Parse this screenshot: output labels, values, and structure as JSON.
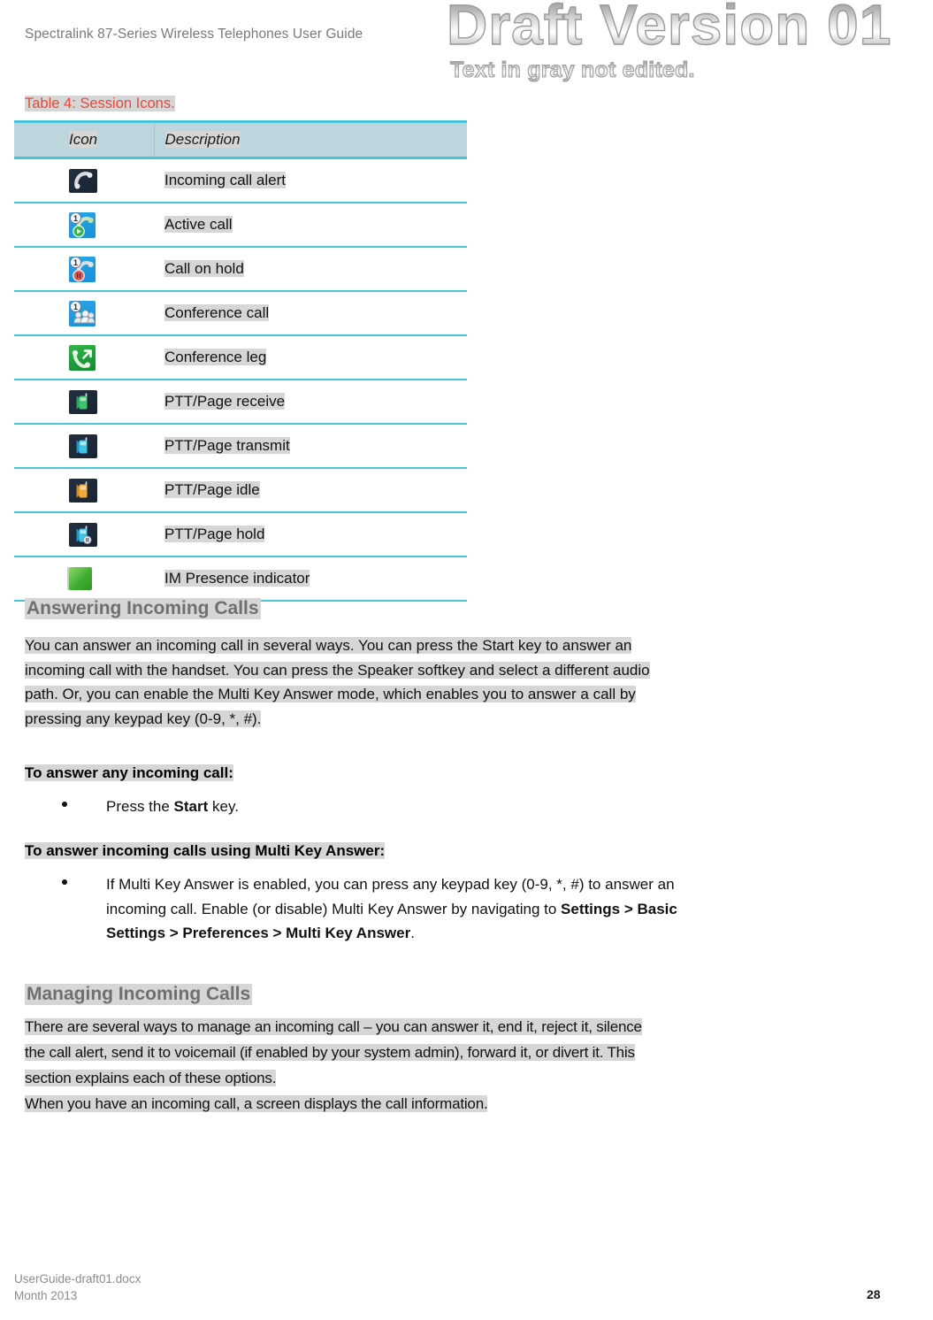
{
  "header": {
    "title": "Spectralink 87-Series Wireless Telephones User Guide"
  },
  "watermark": {
    "line1": "Draft Version 01",
    "line2": "Text in gray not edited."
  },
  "table": {
    "caption": "Table 4: Session Icons.",
    "caption_color": "#e8483a",
    "header_bg": "#bdd6dd",
    "border_color": "#49c3d8",
    "columns": [
      "Icon",
      "Description"
    ],
    "rows": [
      {
        "icon": "incoming-call-alert-icon",
        "description": "Incoming call alert"
      },
      {
        "icon": "active-call-icon",
        "description": "Active call"
      },
      {
        "icon": "call-on-hold-icon",
        "description": "Call on hold"
      },
      {
        "icon": "conference-call-icon",
        "description": "Conference call"
      },
      {
        "icon": "conference-leg-icon",
        "description": "Conference leg"
      },
      {
        "icon": "ptt-page-receive-icon",
        "description": "PTT/Page receive"
      },
      {
        "icon": "ptt-page-transmit-icon",
        "description": "PTT/Page transmit"
      },
      {
        "icon": "ptt-page-idle-icon",
        "description": "PTT/Page idle"
      },
      {
        "icon": "ptt-page-hold-icon",
        "description": "PTT/Page hold"
      },
      {
        "icon": "im-presence-indicator-icon",
        "description": "IM Presence indicator"
      }
    ]
  },
  "sections": {
    "answering": {
      "heading": "Answering Incoming Calls",
      "paragraph_line1": "You can answer an incoming call in several ways. You can press the Start key to answer an",
      "paragraph_line2": "incoming call with the handset. You can press the Speaker softkey and select a different audio",
      "paragraph_line3": "path. Or, you can enable the Multi Key Answer mode, which enables you to answer a call by",
      "paragraph_line4": "pressing any keypad key (0-9, *, #).",
      "lead1": "To answer any incoming call:",
      "bullet1_pre": "Press the ",
      "bullet1_bold": "Start",
      "bullet1_post": " key.",
      "lead2": "To answer incoming calls using Multi Key Answer:",
      "bullet2_line1": "If Multi Key Answer is enabled, you can press any keypad key (0-9, *, #) to answer an",
      "bullet2_line2_pre": "incoming call. Enable (or disable) Multi Key Answer by navigating to ",
      "bullet2_line2_bold": "Settings > Basic",
      "bullet2_line3_bold": "Settings > Preferences > Multi Key Answer",
      "bullet2_line3_post": "."
    },
    "managing": {
      "heading": "Managing Incoming Calls",
      "paragraph_line1": "There are several ways to manage an incoming call – you can answer it, end it, reject it, silence",
      "paragraph_line2": "the call alert, send it to voicemail (if enabled by your system admin), forward it, or divert it. This",
      "paragraph_line3": "section explains each of these options.",
      "paragraph_line4": "When you have an incoming call, a screen displays the call information."
    }
  },
  "footer": {
    "filename": "UserGuide-draft01.docx",
    "date": "Month 2013",
    "page_number": "28"
  }
}
